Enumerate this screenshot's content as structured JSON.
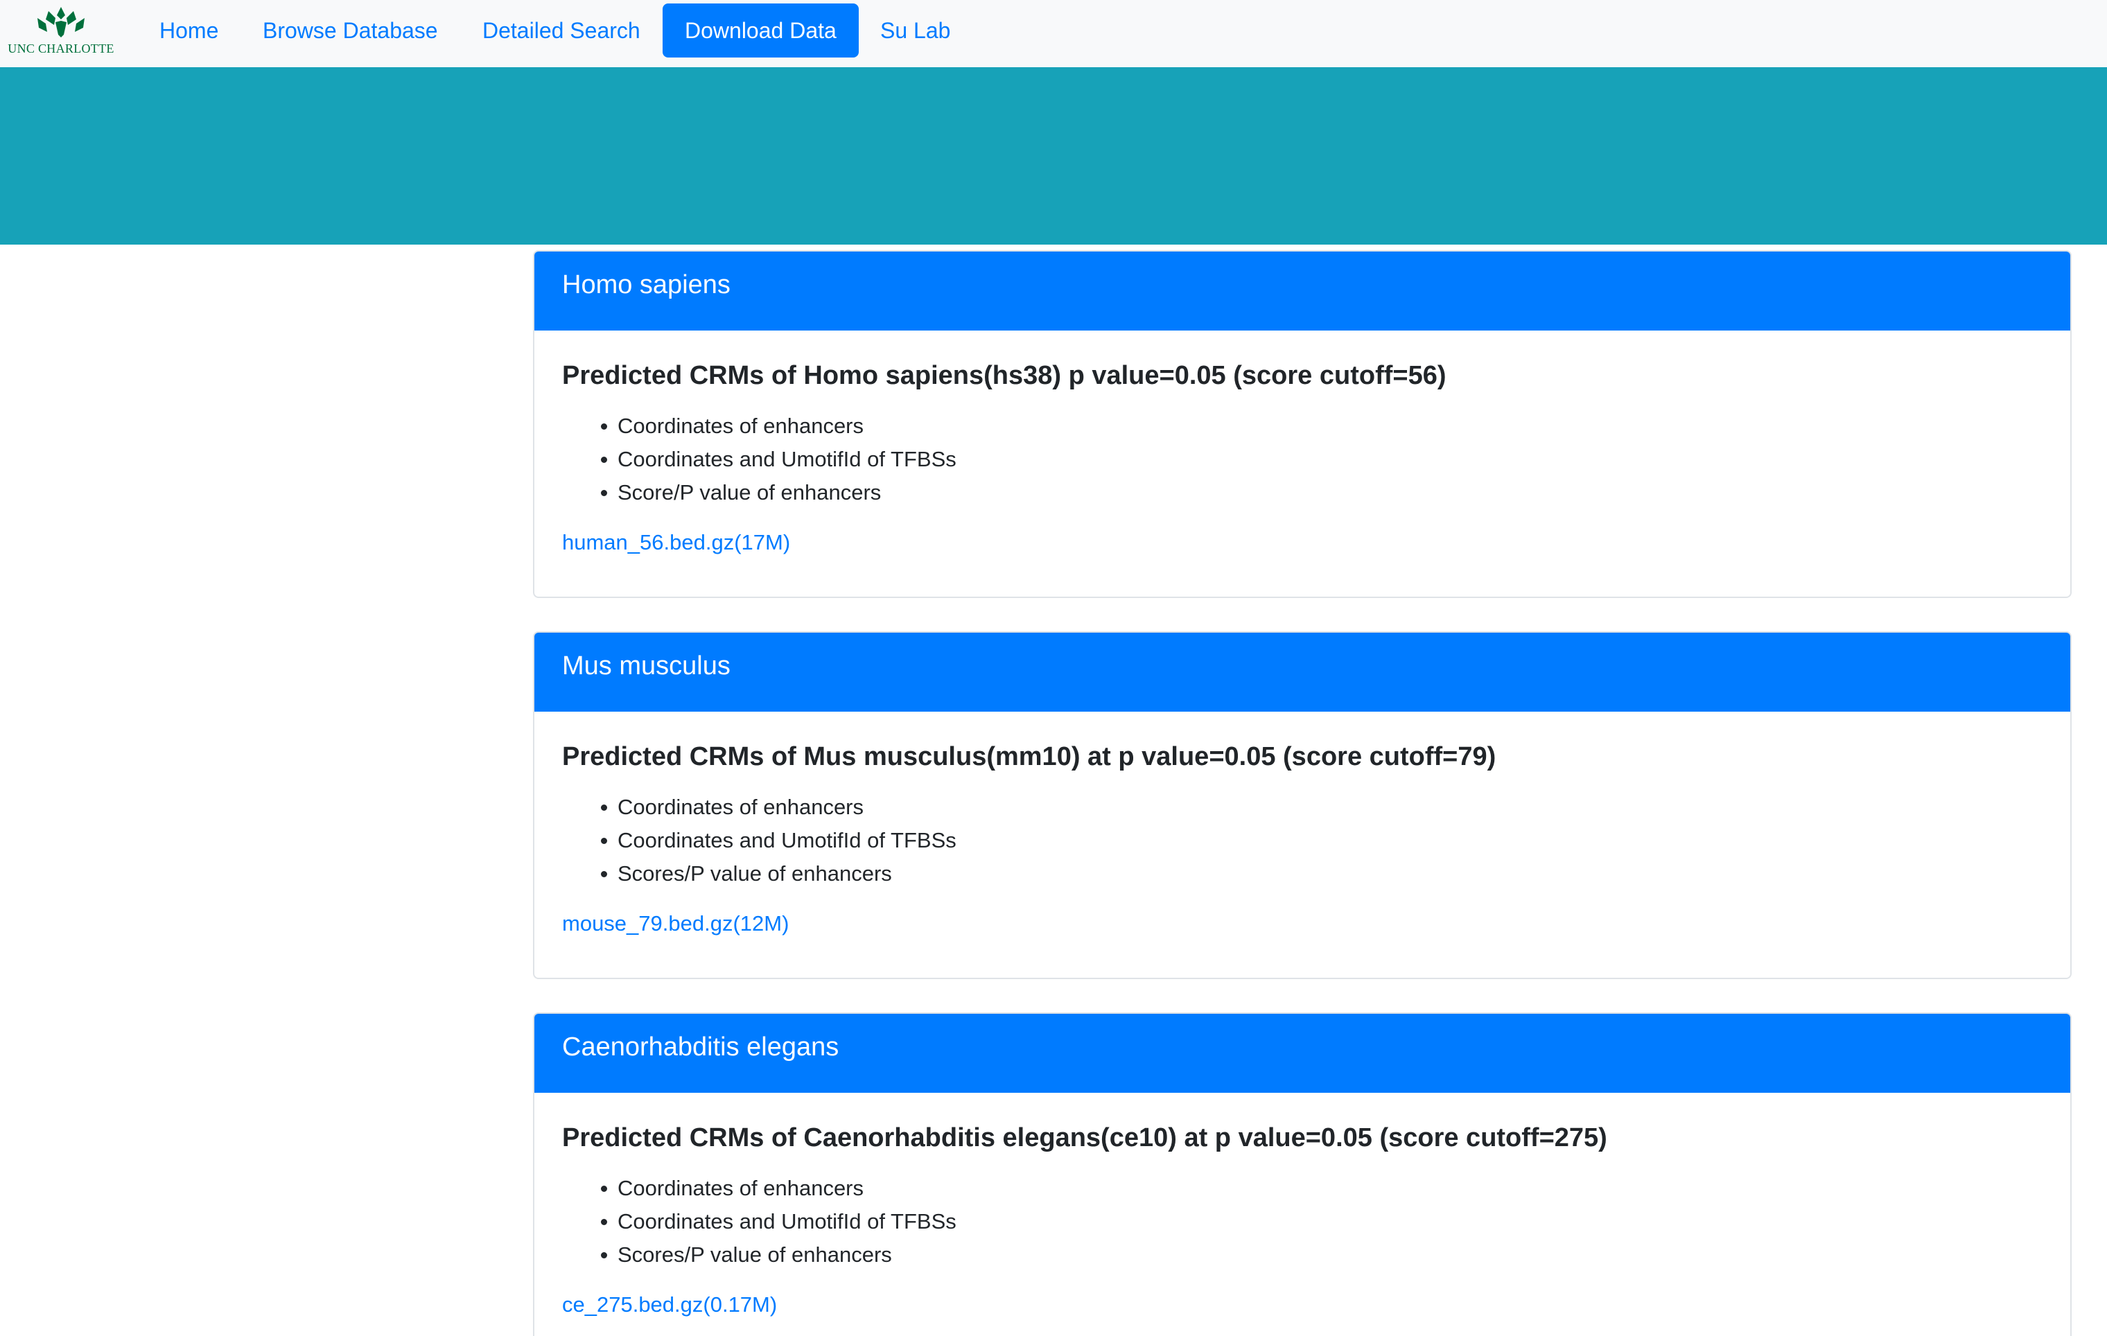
{
  "brand": {
    "logo_text": "UNC CHARLOTTE",
    "logo_icon": "unc-charlotte-crown-logo",
    "color": "#00703c"
  },
  "nav": {
    "items": [
      {
        "label": "Home",
        "active": false
      },
      {
        "label": "Browse Database",
        "active": false
      },
      {
        "label": "Detailed Search",
        "active": false
      },
      {
        "label": "Download Data",
        "active": true
      },
      {
        "label": "Su Lab",
        "active": false
      }
    ]
  },
  "colors": {
    "navbar_bg": "#f8f9fa",
    "banner": "#17a2b8",
    "primary": "#007bff",
    "card_border": "#dfe3e7"
  },
  "cards": [
    {
      "header": "Homo sapiens",
      "title": "Predicted CRMs of Homo sapiens(hs38) p value=0.05 (score cutoff=56)",
      "items": [
        "Coordinates of enhancers",
        "Coordinates and UmotifId of TFBSs",
        "Score/P value of enhancers"
      ],
      "link": "human_56.bed.gz(17M)"
    },
    {
      "header": "Mus musculus",
      "title": "Predicted CRMs of Mus musculus(mm10) at p value=0.05 (score cutoff=79)",
      "items": [
        "Coordinates of enhancers",
        "Coordinates and UmotifId of TFBSs",
        "Scores/P value of enhancers"
      ],
      "link": "mouse_79.bed.gz(12M)"
    },
    {
      "header": "Caenorhabditis elegans",
      "title": "Predicted CRMs of Caenorhabditis elegans(ce10) at p value=0.05 (score cutoff=275)",
      "items": [
        "Coordinates of enhancers",
        "Coordinates and UmotifId of TFBSs",
        "Scores/P value of enhancers"
      ],
      "link": "ce_275.bed.gz(0.17M)"
    }
  ]
}
